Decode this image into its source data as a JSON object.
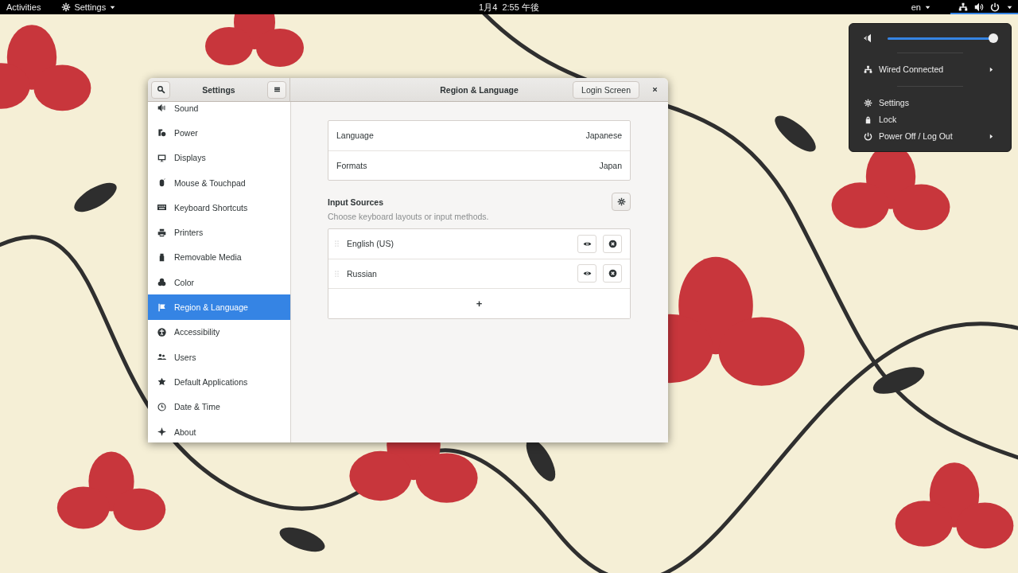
{
  "top_bar": {
    "activities": "Activities",
    "app_menu": "Settings",
    "clock": "1月4  2:55 午後",
    "keyboard": "en"
  },
  "system_menu": {
    "open": true,
    "volume": {
      "level": 1.0
    },
    "sections": [
      [
        {
          "label": "Wired Connected",
          "kind": "submenu"
        }
      ],
      [
        {
          "label": "Settings",
          "kind": "action"
        },
        {
          "label": "Lock",
          "kind": "action"
        },
        {
          "label": "Power Off / Log Out",
          "kind": "submenu"
        }
      ]
    ]
  },
  "window": {
    "title": "Settings",
    "panel_title": "Region & Language",
    "header_button": "Login Screen",
    "sidebar": {
      "items": [
        {
          "label": "Sound",
          "selected": false
        },
        {
          "label": "Power",
          "selected": false
        },
        {
          "label": "Displays",
          "selected": false
        },
        {
          "label": "Mouse & Touchpad",
          "selected": false
        },
        {
          "label": "Keyboard Shortcuts",
          "selected": false
        },
        {
          "label": "Printers",
          "selected": false
        },
        {
          "label": "Removable Media",
          "selected": false
        },
        {
          "label": "Color",
          "selected": false
        },
        {
          "label": "Region & Language",
          "selected": true
        },
        {
          "label": "Accessibility",
          "selected": false
        },
        {
          "label": "Users",
          "selected": false
        },
        {
          "label": "Default Applications",
          "selected": false
        },
        {
          "label": "Date & Time",
          "selected": false
        },
        {
          "label": "About",
          "selected": false
        }
      ]
    },
    "settings_rows": [
      {
        "label": "Language",
        "value": "Japanese"
      },
      {
        "label": "Formats",
        "value": "Japan"
      }
    ],
    "input_sources": {
      "title": "Input Sources",
      "subtitle": "Choose keyboard layouts or input methods.",
      "sources": [
        {
          "name": "English (US)"
        },
        {
          "name": "Russian"
        }
      ],
      "add_button": "+"
    }
  }
}
